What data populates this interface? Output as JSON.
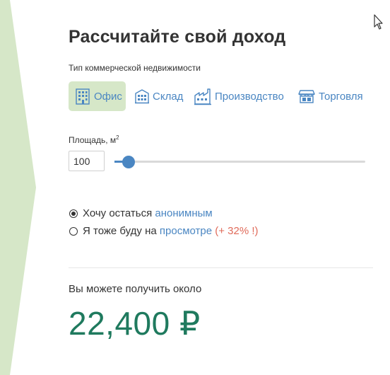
{
  "title": "Рассчитайте свой доход",
  "property_type": {
    "label": "Тип коммерческой недвижимости",
    "options": [
      {
        "label": "Офис",
        "icon": "office-building-icon",
        "selected": true
      },
      {
        "label": "Склад",
        "icon": "warehouse-icon",
        "selected": false
      },
      {
        "label": "Производство",
        "icon": "factory-icon",
        "selected": false
      },
      {
        "label": "Торговля",
        "icon": "shop-icon",
        "selected": false
      }
    ]
  },
  "area": {
    "label": "Площадь, м",
    "unit_superscript": "2",
    "value": "100",
    "slider_fraction": 0.02
  },
  "options": {
    "anonymous": {
      "prefix": "Хочу остаться ",
      "link": "анонимным",
      "selected": true
    },
    "viewing": {
      "prefix": "Я тоже буду на ",
      "link": "просмотре",
      "bonus": " (+ 32% !)",
      "selected": false
    }
  },
  "result": {
    "label": "Вы можете получить около",
    "value": "22,400 ₽"
  },
  "colors": {
    "accent_blue": "#4a86c2",
    "selected_bg": "#d6e7c8",
    "result_green": "#1f7a5e",
    "bonus_red": "#e06b5a",
    "side_arrow": "#d6e7c8"
  }
}
